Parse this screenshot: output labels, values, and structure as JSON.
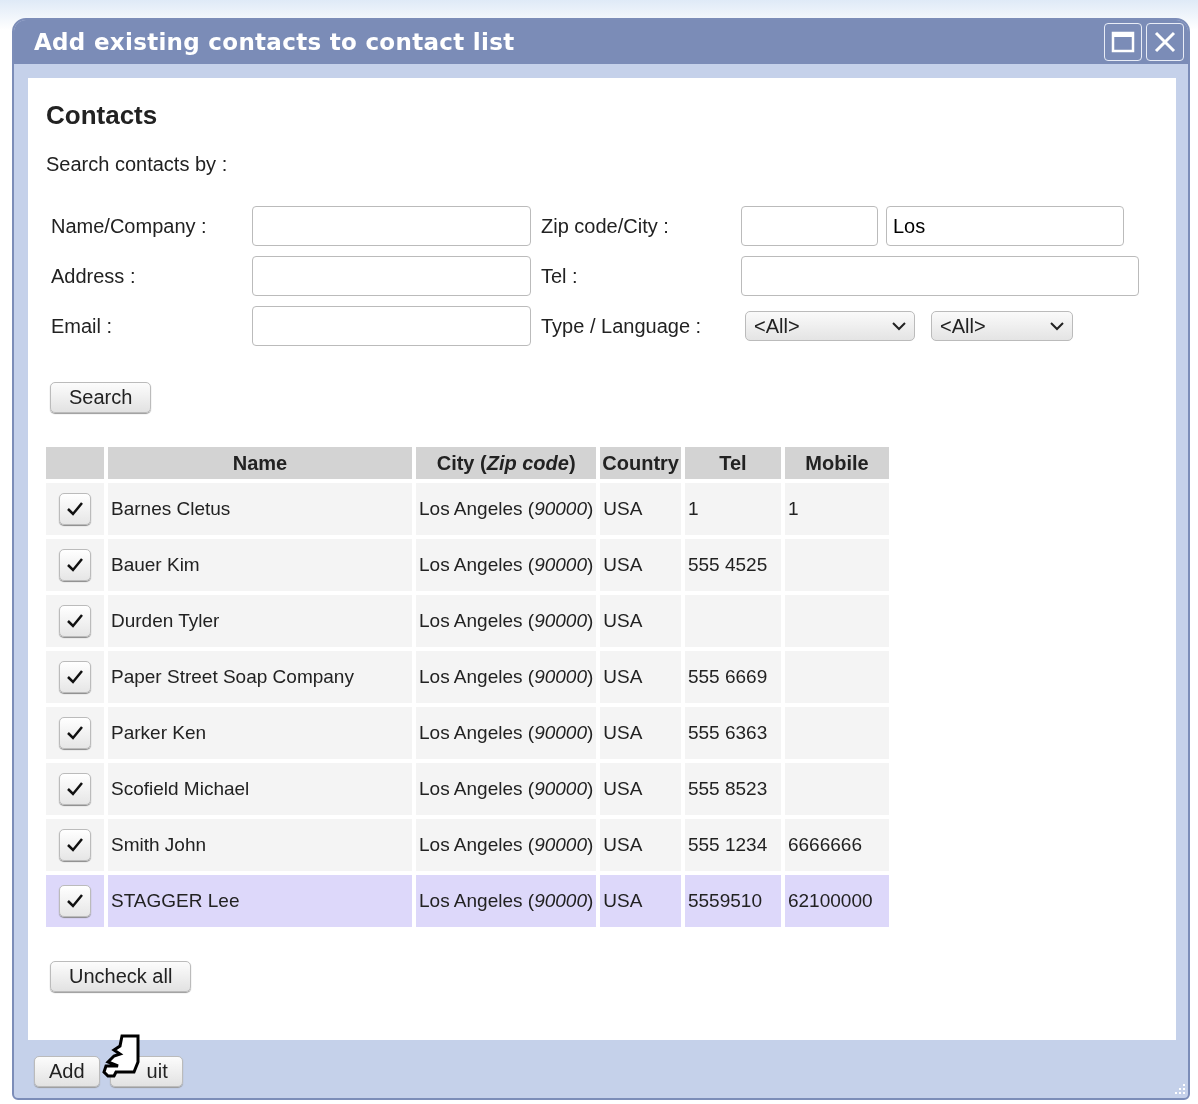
{
  "window": {
    "title": "Add existing contacts to contact list"
  },
  "heading": "Contacts",
  "intro": "Search contacts by :",
  "form": {
    "name_label": "Name/Company :",
    "address_label": "Address :",
    "email_label": "Email :",
    "zip_city_label": "Zip code/City :",
    "tel_label": "Tel :",
    "type_language_label": "Type / Language :",
    "city_value": "Los",
    "type_select": "<All>",
    "language_select": "<All>"
  },
  "search_button": "Search",
  "table": {
    "columns": [
      "Name",
      "City (*Zip code*)",
      "Country",
      "Tel",
      "Mobile"
    ],
    "rows": [
      {
        "checked": true,
        "selected": false,
        "name": "Barnes Cletus",
        "city": "Los Angeles (*90000*)",
        "country": "USA",
        "tel": "1",
        "mobile": "1"
      },
      {
        "checked": true,
        "selected": false,
        "name": "Bauer Kim",
        "city": "Los Angeles (*90000*)",
        "country": "USA",
        "tel": "555 4525"
      },
      {
        "checked": true,
        "selected": false,
        "name": "Durden Tyler",
        "city": "Los Angeles (*90000*)",
        "country": "USA"
      },
      {
        "checked": true,
        "selected": false,
        "name": "Paper Street Soap Company",
        "city": "Los Angeles (*90000*)",
        "country": "USA",
        "tel": "555 6669"
      },
      {
        "checked": true,
        "selected": false,
        "name": "Parker Ken",
        "city": "Los Angeles (*90000*)",
        "country": "USA",
        "tel": "555 6363"
      },
      {
        "checked": true,
        "selected": false,
        "name": "Scofield Michael",
        "city": "Los Angeles (*90000*)",
        "country": "USA",
        "tel": "555 8523"
      },
      {
        "checked": true,
        "selected": false,
        "name": "Smith John",
        "city": "Los Angeles (*90000*)",
        "country": "USA",
        "tel": "555 1234",
        "mobile": "6666666"
      },
      {
        "checked": true,
        "selected": true,
        "name": "STAGGER Lee",
        "city": "Los Angeles (*90000*)",
        "country": "USA",
        "tel": "5559510",
        "mobile": "62100000"
      }
    ]
  },
  "uncheck_button": "Uncheck all",
  "footer_buttons": [
    "Add",
    "uit"
  ]
}
